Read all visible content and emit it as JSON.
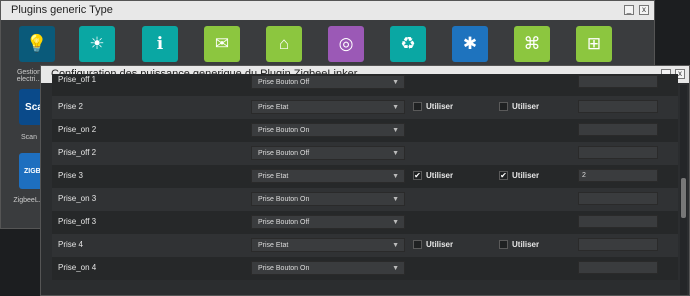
{
  "plugins_window": {
    "title": "Plugins generic Type",
    "side_items": [
      {
        "label": "Gestion electri...",
        "icon": "lightbulb-plug-icon"
      },
      {
        "label": "Scan",
        "icon_text": "Scan"
      },
      {
        "label": "ZigbeeL...",
        "icon_text": "ZIGBEE"
      }
    ],
    "icons": [
      {
        "name": "weather-sun-icon",
        "color": "#0aa7a3"
      },
      {
        "name": "calendar-info-icon",
        "color": "#0aa7a3"
      },
      {
        "name": "mail-icon",
        "color": "#8cc63f"
      },
      {
        "name": "home-automation-icon",
        "color": "#8cc63f"
      },
      {
        "name": "dial-icon",
        "color": "#9b59b6"
      },
      {
        "name": "recycle-bin-icon",
        "color": "#0aa7a3"
      },
      {
        "name": "network-hub-icon",
        "color": "#1e73be"
      },
      {
        "name": "network-icon",
        "color": "#8cc63f"
      },
      {
        "name": "org-chart-icon",
        "color": "#8cc63f"
      }
    ]
  },
  "config_window": {
    "title": "Configuration des puissance generique du Plugin ZigbeeLinker",
    "rows": [
      {
        "label": "Prise_off 1",
        "select": "Prise Bouton Off",
        "checks": false
      },
      {
        "label": "Prise 2",
        "select": "Prise Etat",
        "checks": true,
        "check1": false,
        "check1_label": "Utiliser",
        "check2": false,
        "check2_label": "Utiliser",
        "value": ""
      },
      {
        "label": "Prise_on 2",
        "select": "Prise Bouton On",
        "checks": false
      },
      {
        "label": "Prise_off 2",
        "select": "Prise Bouton Off",
        "checks": false
      },
      {
        "label": "Prise 3",
        "select": "Prise Etat",
        "checks": true,
        "check1": true,
        "check1_label": "Utiliser",
        "check2": true,
        "check2_label": "Utiliser",
        "value": "2"
      },
      {
        "label": "Prise_on 3",
        "select": "Prise Bouton On",
        "checks": false
      },
      {
        "label": "Prise_off 3",
        "select": "Prise Bouton Off",
        "checks": false
      },
      {
        "label": "Prise 4",
        "select": "Prise Etat",
        "checks": true,
        "check1": false,
        "check1_label": "Utiliser",
        "check2": false,
        "check2_label": "Utiliser",
        "value": ""
      },
      {
        "label": "Prise_on 4",
        "select": "Prise Bouton On",
        "checks": false
      }
    ]
  },
  "window_controls": {
    "minimize": "_",
    "close": "x"
  }
}
